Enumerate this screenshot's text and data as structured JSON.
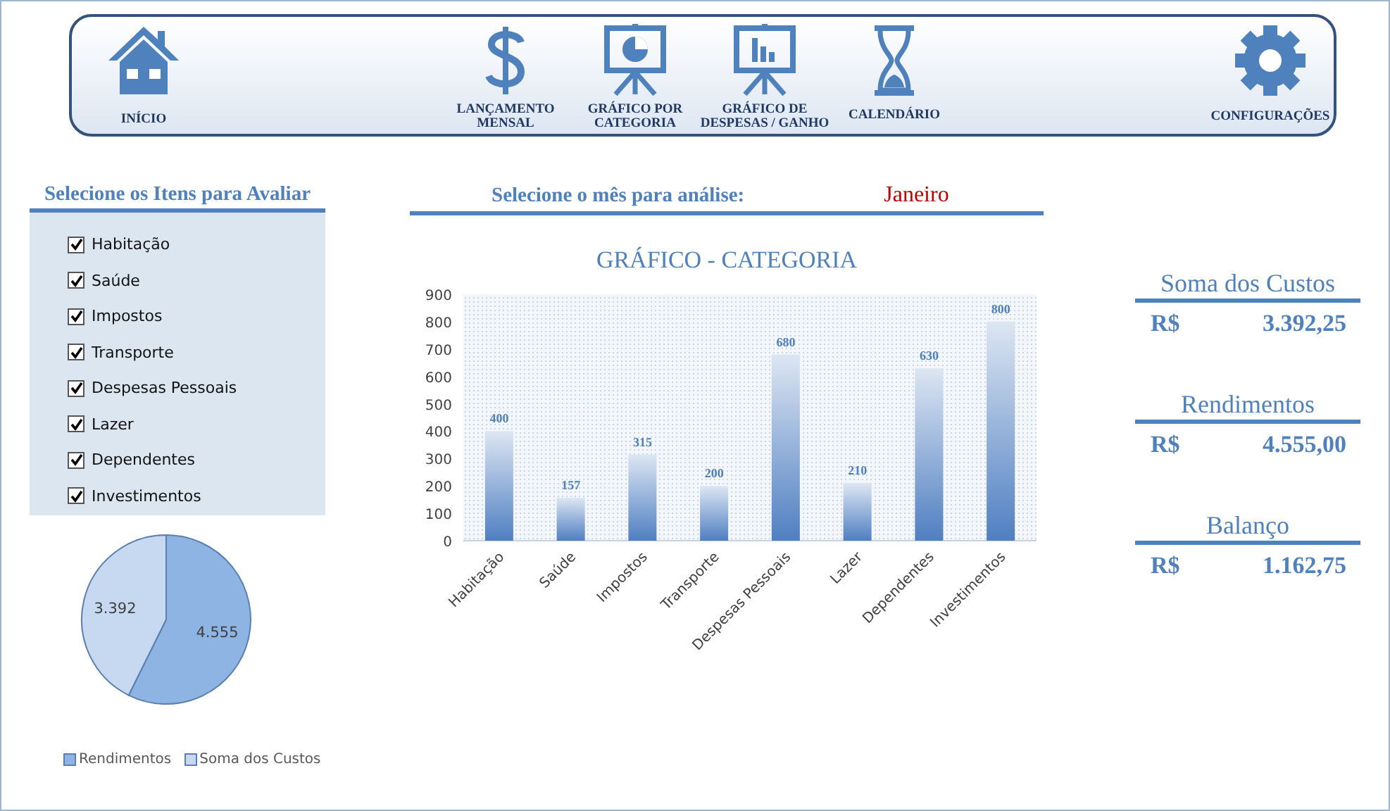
{
  "nav": [
    {
      "label": "INÍCIO",
      "kind": "home"
    },
    {
      "label": "LANÇAMENTO MENSAL",
      "kind": "dollar"
    },
    {
      "label": "GRÁFICO POR CATEGORIA",
      "kind": "pie-board"
    },
    {
      "label": "GRÁFICO DE DESPESAS / GANHO",
      "kind": "bar-board"
    },
    {
      "label": "CALENDÁRIO",
      "kind": "hourglass"
    },
    {
      "label": "CONFIGURAÇÕES",
      "kind": "gear"
    }
  ],
  "filter": {
    "title": "Selecione os Itens para Avaliar",
    "items": [
      {
        "label": "Habitação",
        "checked": true
      },
      {
        "label": "Saúde",
        "checked": true
      },
      {
        "label": "Impostos",
        "checked": true
      },
      {
        "label": "Transporte",
        "checked": true
      },
      {
        "label": "Despesas Pessoais",
        "checked": true
      },
      {
        "label": "Lazer",
        "checked": true
      },
      {
        "label": "Dependentes",
        "checked": true
      },
      {
        "label": "Investimentos",
        "checked": true
      }
    ]
  },
  "pie": {
    "chart_data": {
      "type": "pie",
      "categories": [
        "Rendimentos",
        "Soma dos Custos"
      ],
      "values": [
        4555,
        3392
      ],
      "value_labels": [
        "4.555",
        "3.392"
      ],
      "colors": [
        "#8eb4e3",
        "#c6d9f1"
      ],
      "legend": "bottom"
    }
  },
  "month": {
    "label": "Selecione o mês para análise:",
    "value": "Janeiro"
  },
  "category_chart": {
    "chart_data": {
      "type": "bar",
      "title": "GRÁFICO - CATEGORIA",
      "categories": [
        "Habitação",
        "Saúde",
        "Impostos",
        "Transporte",
        "Despesas Pessoais",
        "Lazer",
        "Dependentes",
        "Investimentos"
      ],
      "values": [
        400,
        157,
        315,
        200,
        680,
        210,
        630,
        800
      ],
      "ylim": [
        0,
        900
      ],
      "yticks": [
        0,
        100,
        200,
        300,
        400,
        500,
        600,
        700,
        800,
        900
      ],
      "data_labels": true
    }
  },
  "summary": [
    {
      "title": "Soma dos Custos",
      "currency": "R$",
      "amount": "3.392,25"
    },
    {
      "title": "Rendimentos",
      "currency": "R$",
      "amount": "4.555,00"
    },
    {
      "title": "Balanço",
      "currency": "R$",
      "amount": "1.162,75"
    }
  ]
}
